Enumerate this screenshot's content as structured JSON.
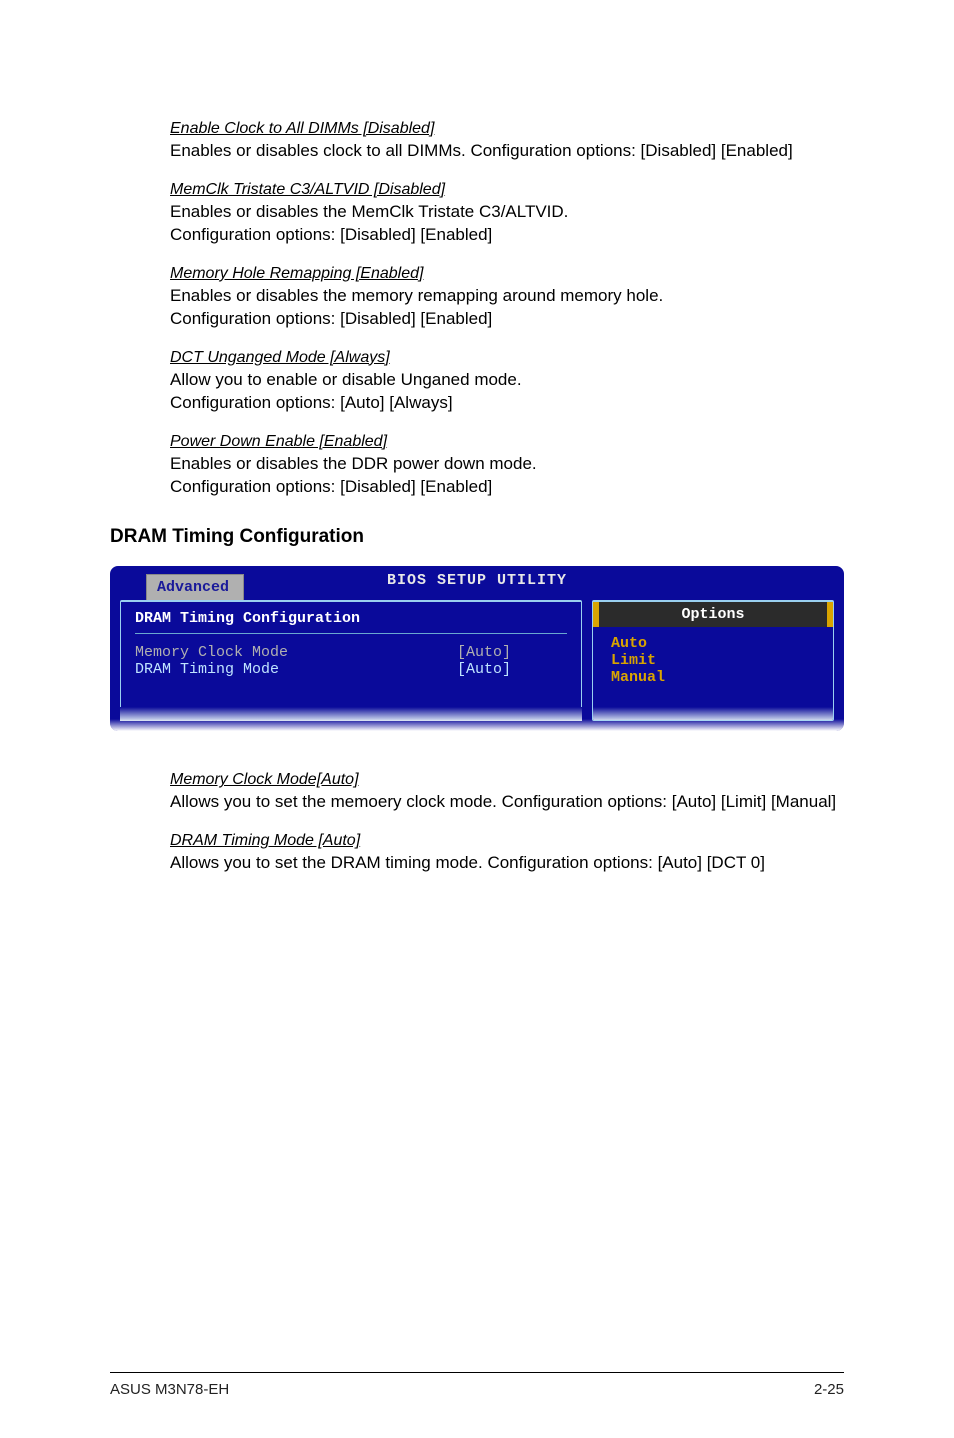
{
  "items": [
    {
      "heading": "Enable Clock to All DIMMs [Disabled]",
      "body": "Enables or disables clock to all DIMMs. Configuration options: [Disabled] [Enabled]"
    },
    {
      "heading": "MemClk Tristate C3/ALTVID [Disabled]",
      "body": "Enables or disables the MemClk Tristate C3/ALTVID.\nConfiguration options: [Disabled] [Enabled]"
    },
    {
      "heading": "Memory Hole Remapping [Enabled]",
      "body": "Enables or disables the memory remapping around memory hole.\nConfiguration options: [Disabled] [Enabled]"
    },
    {
      "heading": "DCT Unganged Mode [Always]",
      "body": "Allow you to enable or disable Unganed mode.\nConfiguration options: [Auto] [Always]"
    },
    {
      "heading": "Power Down Enable [Enabled]",
      "body": "Enables or disables the DDR power down mode.\nConfiguration options: [Disabled] [Enabled]"
    }
  ],
  "section_title": "DRAM Timing Configuration",
  "bios": {
    "header_title": "BIOS SETUP UTILITY",
    "tab": "Advanced",
    "left_title": "DRAM Timing Configuration",
    "rows": [
      {
        "label": "Memory Clock Mode",
        "value": "[Auto]",
        "highlight": true
      },
      {
        "label": "DRAM Timing Mode",
        "value": "[Auto]",
        "highlight": false
      }
    ],
    "right_header": "Options",
    "options": [
      "Auto",
      "Limit",
      "Manual"
    ]
  },
  "post_items": [
    {
      "heading": "Memory Clock Mode[Auto]",
      "body": "Allows you to set the memoery clock mode. Configuration options: [Auto] [Limit] [Manual]"
    },
    {
      "heading": "DRAM Timing Mode [Auto]",
      "body": "Allows you to set the DRAM timing mode. Configuration options: [Auto] [DCT 0]"
    }
  ],
  "footer": {
    "left": "ASUS M3N78-EH",
    "right": "2-25"
  }
}
